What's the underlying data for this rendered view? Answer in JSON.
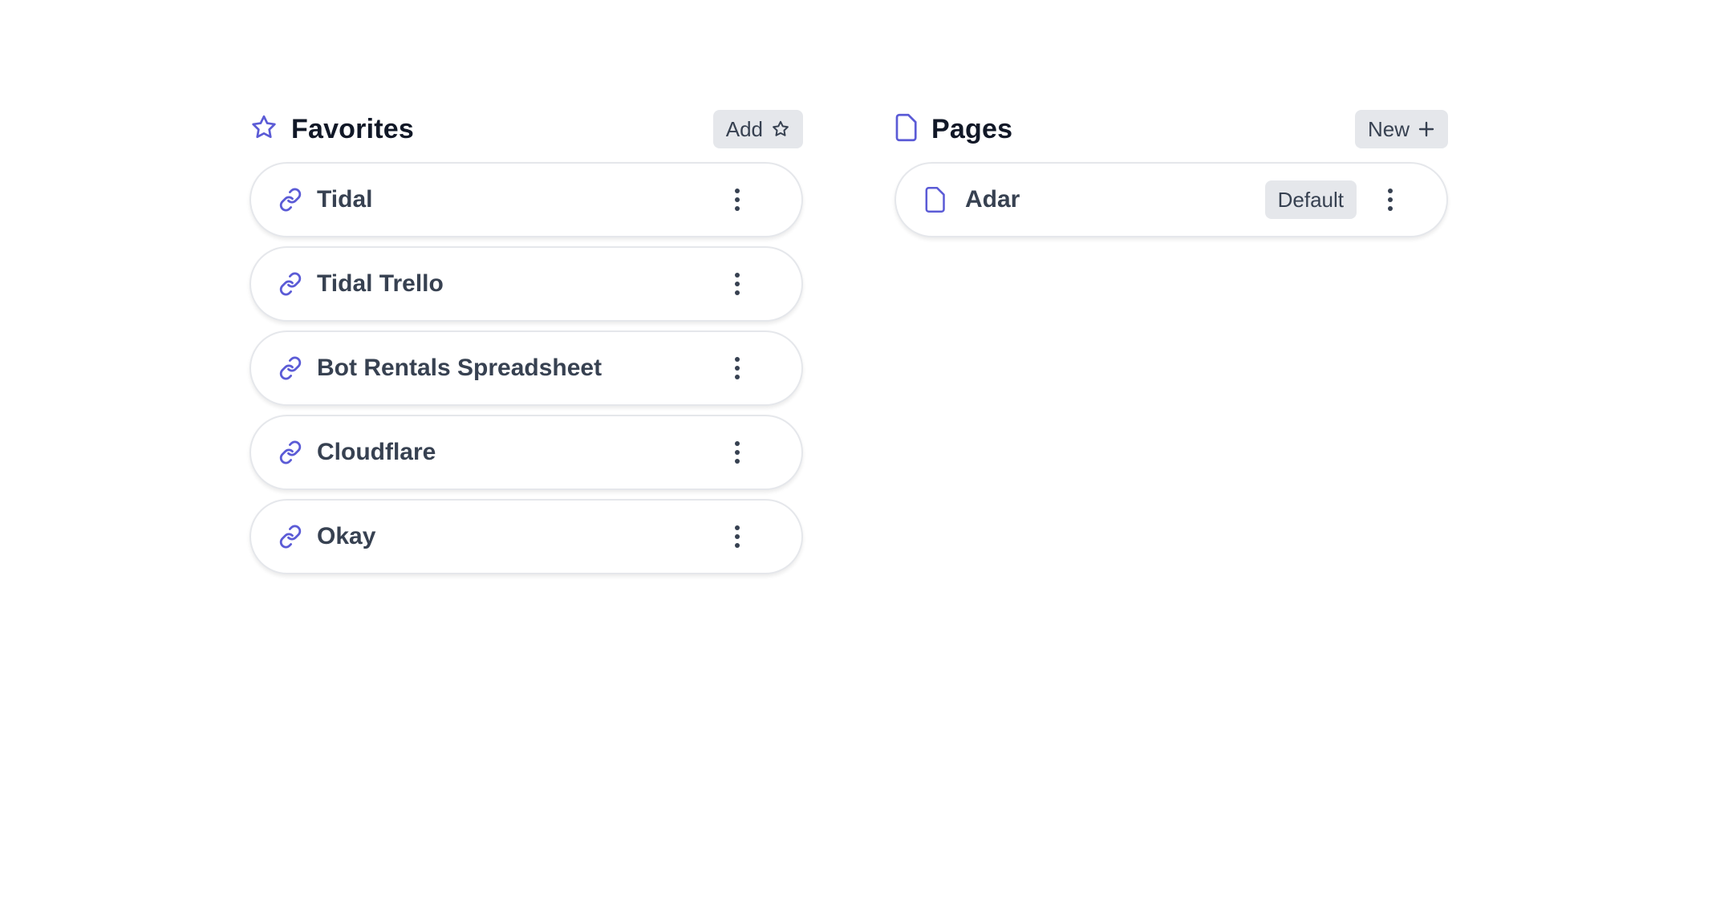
{
  "accent_color": "#5b5bd6",
  "favorites": {
    "title": "Favorites",
    "title_icon": "star-icon",
    "add_button": {
      "label": "Add",
      "icon": "star-outline-icon"
    },
    "items": [
      {
        "label": "Tidal",
        "icon": "link-icon",
        "menu_icon": "more-vertical-icon"
      },
      {
        "label": "Tidal Trello",
        "icon": "link-icon",
        "menu_icon": "more-vertical-icon"
      },
      {
        "label": "Bot Rentals Spreadsheet",
        "icon": "link-icon",
        "menu_icon": "more-vertical-icon"
      },
      {
        "label": "Cloudflare",
        "icon": "link-icon",
        "menu_icon": "more-vertical-icon"
      },
      {
        "label": "Okay",
        "icon": "link-icon",
        "menu_icon": "more-vertical-icon"
      }
    ]
  },
  "pages": {
    "title": "Pages",
    "title_icon": "document-icon",
    "new_button": {
      "label": "New",
      "icon": "plus-icon"
    },
    "items": [
      {
        "label": "Adar",
        "icon": "document-icon",
        "badge": "Default",
        "menu_icon": "more-vertical-icon"
      }
    ]
  }
}
